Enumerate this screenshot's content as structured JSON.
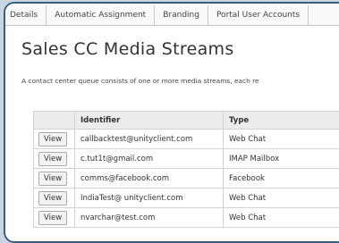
{
  "tabs": [
    "Details",
    "Automatic Assignment",
    "Branding",
    "Portal User Accounts"
  ],
  "page": {
    "title": "Sales CC Media Streams",
    "description": "A contact center queue consists of one or more media streams, each re"
  },
  "table": {
    "headers": [
      "",
      "Identifier",
      "Type"
    ],
    "view_label": "View",
    "rows": [
      {
        "identifier": "callbacktest@unityclient.com",
        "type": "Web Chat"
      },
      {
        "identifier": "c.tut1t@gmail.com",
        "type": "IMAP Mailbox"
      },
      {
        "identifier": "comms@facebook.com",
        "type": "Facebook"
      },
      {
        "identifier": "IndiaTest@ unityclient.com",
        "type": "Web Chat"
      },
      {
        "identifier": "nvarchar@test.com",
        "type": "Web Chat"
      }
    ]
  }
}
